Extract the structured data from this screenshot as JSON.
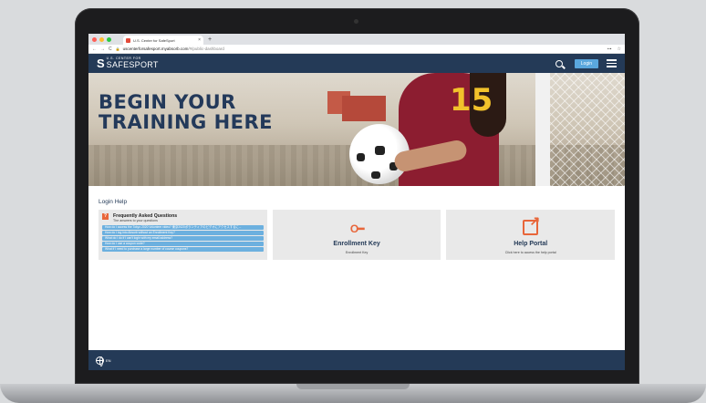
{
  "browser": {
    "tab_title": "U.S. Center for SafeSport",
    "tab_close": "×",
    "new_tab": "+",
    "url_host": "uscenterforsafesport.myabsorb.com",
    "url_path": "/#/public-dashboard",
    "nav_back": "←",
    "nav_forward": "→",
    "nav_reload": "C",
    "lock": "🔒",
    "key_icon": "⊶",
    "star_icon": "☆"
  },
  "header": {
    "logo_small": "U.S. CENTER FOR",
    "logo_big": "SAFESPORT",
    "logo_mark": "S",
    "login_label": "Login"
  },
  "hero": {
    "title_line1": "BEGIN YOUR",
    "title_line2": "TRAINING HERE",
    "jersey_number": "15"
  },
  "main": {
    "login_help": "Login Help",
    "faq": {
      "icon": "?",
      "title": "Frequently Asked Questions",
      "subtitle": "The answers to your questions",
      "items": [
        "How do I access the Tokyo 2020 Volunteer video? 東京2020ボランティアのビデオにアクセスするに...",
        "How do I log into Absorb without an Enrollment Key?",
        "What do I do if I can't login with my email address?",
        "How do I use a coupon code?",
        "What if I need to purchase a large number of course coupons?"
      ]
    },
    "enrollment": {
      "icon": "O━",
      "title": "Enrollment Key",
      "subtitle": "Enrollment Key"
    },
    "help_portal": {
      "title": "Help Portal",
      "subtitle": "Click here to access the help portal"
    }
  },
  "footer": {
    "language": "EN"
  },
  "colors": {
    "navy": "#243a57",
    "accent_orange": "#e8663a",
    "link_blue": "#6cb0df",
    "login_blue": "#5aa7dd"
  }
}
